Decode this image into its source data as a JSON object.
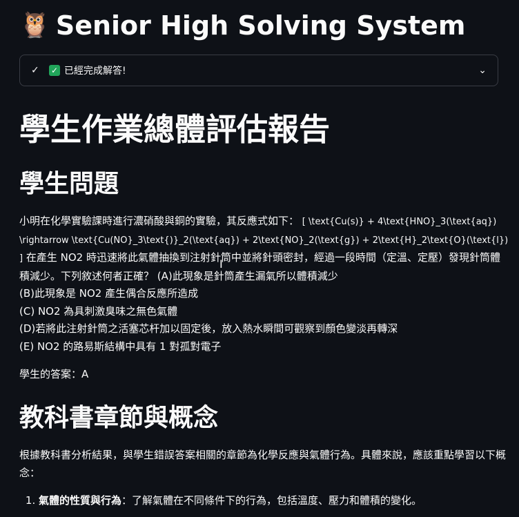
{
  "app": {
    "icon": "owl-emoji",
    "title": "Senior High Solving System"
  },
  "status": {
    "check_icon": "check-icon",
    "badge_icon": "green-check-icon",
    "text": "已經完成解答!",
    "expand_icon": "chevron-down-icon"
  },
  "report": {
    "title": "學生作業總體評估報告",
    "question_heading": "學生問題",
    "question_intro": "小明在化學實驗課時進行濃硝酸與銅的實驗，其反應式如下：",
    "question_formula": "[ \\text{Cu(s)} + 4\\text{HNO}_3(\\text{aq}) \\rightarrow \\text{Cu(NO}_3\\text{)}_2(\\text{aq}) + 2\\text{NO}_2(\\text{g}) + 2\\text{H}_2\\text{O}(\\text{l}) ]",
    "question_body": "在產生 NO2 時迅速將此氣體抽換到注射針筒中並將針頭密封，經過一段時間（定溫、定壓）發現針筒體積減少。下列敘述何者正確？ (A)此現象是針筒產生漏氣所以體積減少",
    "option_b": "(B)此現象是 NO2 產生偶合反應所造成",
    "option_c": "(C) NO2 為具刺激臭味之無色氣體",
    "option_d": "(D)若將此注射針筒之活塞芯杆加以固定後，放入熱水瞬間可觀察到顏色變淡再轉深",
    "option_e": "(E) NO2 的路易斯結構中具有 1 對孤對電子",
    "student_answer": "學生的答案：A",
    "textbook_heading": "教科書章節與概念",
    "analysis_text": "根據教科書分析結果，與學生錯誤答案相關的章節為化學反應與氣體行為。具體來說，應該重點學習以下概念：",
    "concepts": [
      {
        "label": "氣體的性質與行為",
        "text": "：了解氣體在不同條件下的行為，包括溫度、壓力和體積的變化。"
      }
    ]
  }
}
